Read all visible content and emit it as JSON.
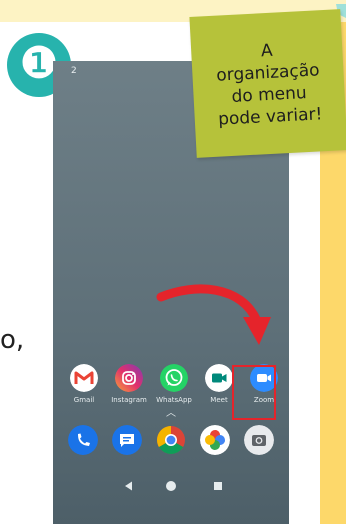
{
  "step": {
    "number": "❶"
  },
  "note": {
    "lines": [
      "A",
      "organização",
      "do menu",
      "pode variar!"
    ]
  },
  "status": {
    "time": "2"
  },
  "edge_text": "o,",
  "apps": [
    {
      "label": "Gmail",
      "icon": "gmail-icon"
    },
    {
      "label": "Instagram",
      "icon": "instagram-icon"
    },
    {
      "label": "WhatsApp",
      "icon": "whatsapp-icon"
    },
    {
      "label": "Meet",
      "icon": "meet-icon"
    },
    {
      "label": "Zoom",
      "icon": "zoom-icon"
    }
  ],
  "dock": [
    {
      "icon": "phone-icon"
    },
    {
      "icon": "messages-icon"
    },
    {
      "icon": "chrome-icon"
    },
    {
      "icon": "photos-icon"
    },
    {
      "icon": "camera-icon"
    }
  ],
  "colors": {
    "badge": "#27b3ad",
    "note": "#b6c23a",
    "highlight": "#e5242b",
    "arrow": "#e5242b",
    "side_strip": "#fdd86a",
    "top_strip": "#fdf3c4"
  }
}
